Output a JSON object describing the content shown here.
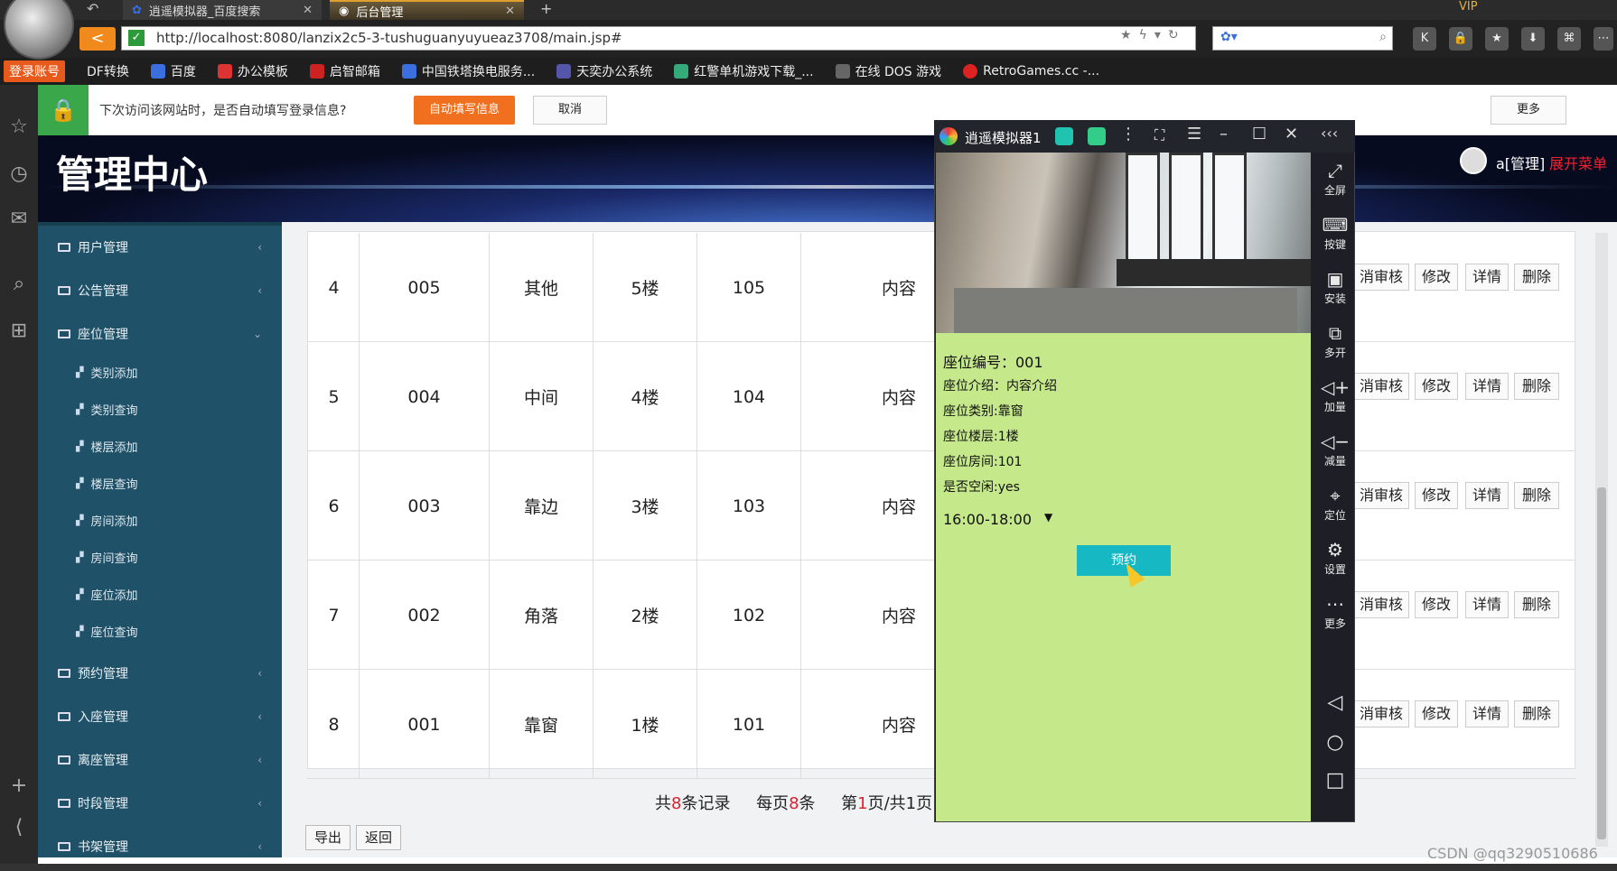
{
  "browser": {
    "tabs": [
      {
        "label": "逍遥模拟器_百度搜索"
      },
      {
        "label": "后台管理"
      }
    ],
    "new_tab": "+",
    "back": "<",
    "url": "http://localhost:8080/lanzix2c5-3-tushuguanyuyueaz3708/main.jsp#",
    "vip": "VIP",
    "bookmarks": [
      {
        "label": "登录账号"
      },
      {
        "label": "DF转换"
      },
      {
        "label": "百度"
      },
      {
        "label": "办公模板"
      },
      {
        "label": "启智邮箱"
      },
      {
        "label": "中国铁塔换电服务..."
      },
      {
        "label": "天奕办公系统"
      },
      {
        "label": "红警单机游戏下载_..."
      },
      {
        "label": "在线 DOS 游戏"
      },
      {
        "label": "RetroGames.cc -..."
      }
    ]
  },
  "notice": {
    "text": "下次访问该网站时，是否自动填写登录信息?",
    "autofill": "自动填写信息",
    "cancel": "取消",
    "more": "更多"
  },
  "header": {
    "title": "管理中心",
    "user": "a[管理]",
    "expand_menu": "展开菜单"
  },
  "sidebar": {
    "items": [
      {
        "label": "用户管理"
      },
      {
        "label": "公告管理"
      },
      {
        "label": "座位管理",
        "expanded": true
      },
      {
        "label": "预约管理"
      },
      {
        "label": "入座管理"
      },
      {
        "label": "离座管理"
      },
      {
        "label": "时段管理"
      },
      {
        "label": "书架管理"
      }
    ],
    "subitems": [
      {
        "label": "类别添加"
      },
      {
        "label": "类别查询"
      },
      {
        "label": "楼层添加"
      },
      {
        "label": "楼层查询"
      },
      {
        "label": "房间添加"
      },
      {
        "label": "房间查询"
      },
      {
        "label": "座位添加"
      },
      {
        "label": "座位查询"
      }
    ]
  },
  "table": {
    "rows": [
      {
        "idx": "4",
        "code": "005",
        "type": "其他",
        "floor": "5楼",
        "room": "105",
        "intro": "内容"
      },
      {
        "idx": "5",
        "code": "004",
        "type": "中间",
        "floor": "4楼",
        "room": "104",
        "intro": "内容"
      },
      {
        "idx": "6",
        "code": "003",
        "type": "靠边",
        "floor": "3楼",
        "room": "103",
        "intro": "内容"
      },
      {
        "idx": "7",
        "code": "002",
        "type": "角落",
        "floor": "2楼",
        "room": "102",
        "intro": "内容"
      },
      {
        "idx": "8",
        "code": "001",
        "type": "靠窗",
        "floor": "1楼",
        "room": "101",
        "intro": "内容"
      }
    ],
    "actions": {
      "review": "消审核",
      "edit": "修改",
      "detail": "详情",
      "delete": "删除"
    }
  },
  "pagination": {
    "total_prefix": "共",
    "total": "8",
    "total_suffix": "条记录",
    "per_page_prefix": "每页",
    "per_page": "8",
    "per_page_suffix": "条",
    "page_prefix": "第",
    "page": "1",
    "page_suffix": "页/共1页"
  },
  "buttons": {
    "export": "导出",
    "back": "返回"
  },
  "emulator": {
    "title": "逍遥模拟器1",
    "seat_no": "座位编号：001",
    "seat_intro": "座位介绍：内容介绍",
    "seat_type": "座位类别:靠窗",
    "seat_floor": "座位楼层:1楼",
    "seat_room": "座位房间:101",
    "is_free": "是否空闲:yes",
    "time_slot": "16:00-18:00",
    "book_button": "预约",
    "tools": [
      {
        "label": "全屏"
      },
      {
        "label": "按键"
      },
      {
        "label": "安装"
      },
      {
        "label": "多开"
      },
      {
        "label": "加量"
      },
      {
        "label": "减量"
      },
      {
        "label": "定位"
      },
      {
        "label": "设置"
      },
      {
        "label": "更多"
      }
    ]
  },
  "watermark": "CSDN @qq3290510686"
}
